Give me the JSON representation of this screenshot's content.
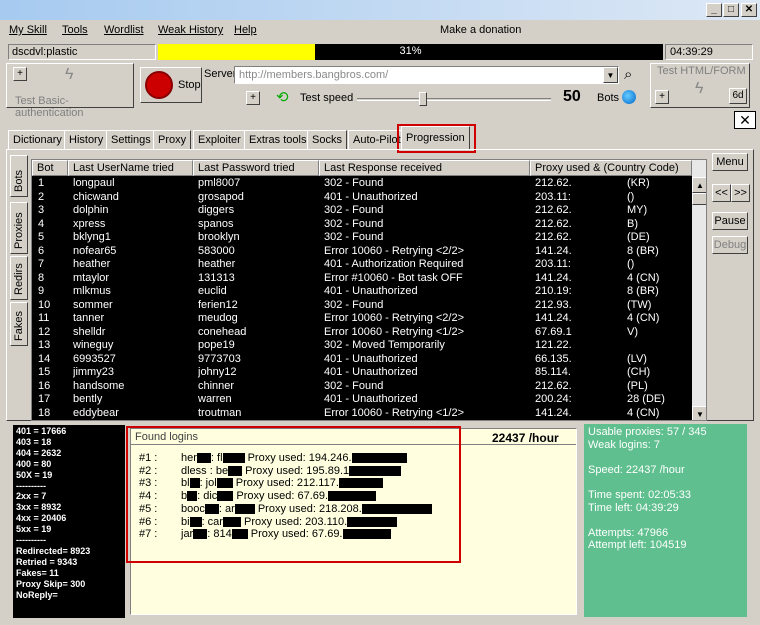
{
  "menu": [
    "My Skill",
    "Tools",
    "Wordlist",
    "Weak History",
    "Help",
    "Make a donation"
  ],
  "status": {
    "target": "dscdvl:plastic",
    "progress_pct": "31%",
    "progress": 0.31,
    "time": "04:39:29"
  },
  "toolbar": {
    "test_basic": "Test Basic-authentication",
    "stop": "Stop",
    "server_label": "Server",
    "server_value": "http://members.bangbros.com/",
    "test_speed": "Test speed",
    "speed": "50",
    "bots": "Bots",
    "test_html": "Test HTML/FORM",
    "sixd": "6d"
  },
  "tabs": [
    "Dictionary",
    "History",
    "Settings",
    "Proxy",
    "Exploiter",
    "Extras tools",
    "Socks",
    "Auto-Pilot",
    "Progression"
  ],
  "side_tabs": [
    "Bots",
    "Proxies",
    "Redirs",
    "Fakes"
  ],
  "right_buttons": {
    "menu": "Menu",
    "prev": "<<",
    "next": ">>",
    "pause": "Pause",
    "debug": "Debug"
  },
  "columns": [
    "Bot",
    "Last UserName tried",
    "Last Password tried",
    "Last Response received",
    "Proxy used & (Country Code)"
  ],
  "rows": [
    [
      "1",
      "longpaul",
      "pml8007",
      "302 - Found",
      "212.62.",
      "(KR)"
    ],
    [
      "2",
      "chicwand",
      "grosapod",
      "401 - Unauthorized",
      "203.11:",
      "()"
    ],
    [
      "3",
      "dolphin",
      "diggers",
      "302 - Found",
      "212.62.",
      "MY)"
    ],
    [
      "4",
      "xpress",
      "spanos",
      "302 - Found",
      "212.62.",
      "B)"
    ],
    [
      "5",
      "bklyng1",
      "brooklyn",
      "302 - Found",
      "212.62.",
      "(DE)"
    ],
    [
      "6",
      "nofear65",
      "583000",
      "Error 10060 - Retrying <2/2>",
      "141.24.",
      "8 (BR)"
    ],
    [
      "7",
      "heather",
      "heather",
      "401 - Authorization Required",
      "203.11:",
      "()"
    ],
    [
      "8",
      "mtaylor",
      "131313",
      "Error #10060 - Bot task OFF",
      "141.24.",
      "4 (CN)"
    ],
    [
      "9",
      "mlkmus",
      "euclid",
      "401 - Unauthorized",
      "210.19:",
      "8 (BR)"
    ],
    [
      "10",
      "sommer",
      "ferien12",
      "302 - Found",
      "212.93.",
      "(TW)"
    ],
    [
      "11",
      "tanner",
      "meudog",
      "Error 10060 - Retrying <2/2>",
      "141.24.",
      "4 (CN)"
    ],
    [
      "12",
      "shelldr",
      "conehead",
      "Error 10060 - Retrying <1/2>",
      "67.69.1",
      "V)"
    ],
    [
      "13",
      "wineguy",
      "pope19",
      "302 - Moved Temporarily",
      "121.22.",
      ""
    ],
    [
      "14",
      "6993527",
      "9773703",
      "401 - Unauthorized",
      "66.135.",
      "(LV)"
    ],
    [
      "15",
      "jimmy23",
      "johny12",
      "401 - Unauthorized",
      "85.114.",
      "(CH)"
    ],
    [
      "16",
      "handsome",
      "chinner",
      "302 - Found",
      "212.62.",
      "(PL)"
    ],
    [
      "17",
      "bently",
      "warren",
      "401 - Unauthorized",
      "200.24:",
      "28 (DE)"
    ],
    [
      "18",
      "eddybear",
      "troutman",
      "Error 10060 - Retrying <1/2>",
      "141.24.",
      "4 (CN)"
    ]
  ],
  "left_stats": [
    "401 = 17666",
    "403 = 18",
    "404 = 2632",
    "400 = 80",
    "50X = 19",
    "----------",
    "2xx = 7",
    "3xx = 8932",
    "4xx = 20406",
    "5xx = 19",
    "----------",
    "Redirected= 8923",
    "Retried = 9343",
    "Fakes= 11",
    "Proxy Skip= 300",
    "NoReply="
  ],
  "found": {
    "title": "Found logins",
    "rate": "22437 /hour",
    "entries": [
      [
        "#1 :",
        "her",
        ": fl",
        "Proxy used: 194.246."
      ],
      [
        "#2 :",
        "",
        "dless : be",
        "Proxy used: 195.89.1"
      ],
      [
        "#3 :",
        "bl",
        ": jol",
        "Proxy used: 212.117."
      ],
      [
        "#4 :",
        "b",
        ": dic",
        "Proxy used: 67.69."
      ],
      [
        "#5 :",
        "booc",
        ": ar",
        "Proxy used: 218.208."
      ],
      [
        "#6 :",
        "bi",
        ": car",
        "Proxy used: 203.110."
      ],
      [
        "#7 :",
        "jar",
        ": 814",
        "Proxy used: 67.69."
      ]
    ]
  },
  "green": [
    "Usable proxies: 57 / 345",
    "Weak logins: 7",
    "",
    "Speed: 22437 /hour",
    "",
    "Time spent: 02:05:33",
    "Time left:  04:39:29",
    "",
    "Attempts: 47966",
    "Attempt left: 104519"
  ]
}
